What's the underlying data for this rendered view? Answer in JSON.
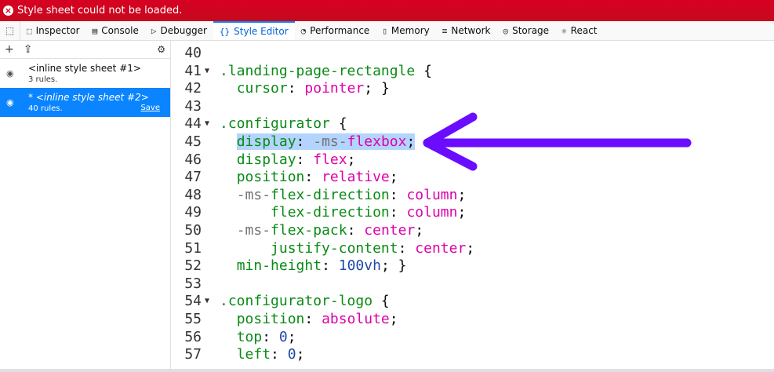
{
  "error_bar": {
    "message": "Style sheet could not be loaded."
  },
  "toolbar": {
    "tabs": [
      {
        "label": "Inspector",
        "icon": "inspector-icon",
        "glyph": "⬚"
      },
      {
        "label": "Console",
        "icon": "console-icon",
        "glyph": "▤"
      },
      {
        "label": "Debugger",
        "icon": "debugger-icon",
        "glyph": "▷"
      },
      {
        "label": "Style Editor",
        "icon": "style-editor-icon",
        "glyph": "{}"
      },
      {
        "label": "Performance",
        "icon": "performance-icon",
        "glyph": "◔"
      },
      {
        "label": "Memory",
        "icon": "memory-icon",
        "glyph": "▯"
      },
      {
        "label": "Network",
        "icon": "network-icon",
        "glyph": "≡"
      },
      {
        "label": "Storage",
        "icon": "storage-icon",
        "glyph": "◎"
      },
      {
        "label": "React",
        "icon": "react-icon",
        "glyph": "⚛"
      }
    ],
    "selected_tab": "Style Editor"
  },
  "sidebar": {
    "sheets": [
      {
        "name": "<inline style sheet #1>",
        "rules": "3 rules."
      },
      {
        "name": "* <inline style sheet #2>",
        "rules": "40 rules.",
        "save_label": "Save"
      }
    ]
  },
  "editor": {
    "lines": [
      {
        "n": "40",
        "fold": false,
        "tokens": []
      },
      {
        "n": "41",
        "fold": true,
        "tokens": [
          [
            "sel",
            ".landing-page-rectangle"
          ],
          [
            "pun",
            " {"
          ]
        ]
      },
      {
        "n": "42",
        "fold": false,
        "tokens": [
          [
            "pun",
            "  "
          ],
          [
            "prop",
            "cursor"
          ],
          [
            "pun",
            ": "
          ],
          [
            "val",
            "pointer"
          ],
          [
            "pun",
            "; }"
          ]
        ]
      },
      {
        "n": "43",
        "fold": false,
        "tokens": []
      },
      {
        "n": "44",
        "fold": true,
        "tokens": [
          [
            "sel",
            ".configurator"
          ],
          [
            "pun",
            " {"
          ]
        ]
      },
      {
        "n": "45",
        "fold": false,
        "highlight": true,
        "tokens": [
          [
            "prop",
            "display"
          ],
          [
            "pun",
            ": "
          ],
          [
            "vendor",
            "-ms-"
          ],
          [
            "val",
            "flexbox"
          ],
          [
            "pun",
            ";"
          ]
        ]
      },
      {
        "n": "46",
        "fold": false,
        "tokens": [
          [
            "pun",
            "  "
          ],
          [
            "prop",
            "display"
          ],
          [
            "pun",
            ": "
          ],
          [
            "val",
            "flex"
          ],
          [
            "pun",
            ";"
          ]
        ]
      },
      {
        "n": "47",
        "fold": false,
        "tokens": [
          [
            "pun",
            "  "
          ],
          [
            "prop",
            "position"
          ],
          [
            "pun",
            ": "
          ],
          [
            "val",
            "relative"
          ],
          [
            "pun",
            ";"
          ]
        ]
      },
      {
        "n": "48",
        "fold": false,
        "tokens": [
          [
            "pun",
            "  "
          ],
          [
            "vendor",
            "-ms-"
          ],
          [
            "prop",
            "flex-direction"
          ],
          [
            "pun",
            ": "
          ],
          [
            "val",
            "column"
          ],
          [
            "pun",
            ";"
          ]
        ]
      },
      {
        "n": "49",
        "fold": false,
        "tokens": [
          [
            "pun",
            "      "
          ],
          [
            "prop",
            "flex-direction"
          ],
          [
            "pun",
            ": "
          ],
          [
            "val",
            "column"
          ],
          [
            "pun",
            ";"
          ]
        ]
      },
      {
        "n": "50",
        "fold": false,
        "tokens": [
          [
            "pun",
            "  "
          ],
          [
            "vendor",
            "-ms-"
          ],
          [
            "prop",
            "flex-pack"
          ],
          [
            "pun",
            ": "
          ],
          [
            "val",
            "center"
          ],
          [
            "pun",
            ";"
          ]
        ]
      },
      {
        "n": "51",
        "fold": false,
        "tokens": [
          [
            "pun",
            "      "
          ],
          [
            "prop",
            "justify-content"
          ],
          [
            "pun",
            ": "
          ],
          [
            "val",
            "center"
          ],
          [
            "pun",
            ";"
          ]
        ]
      },
      {
        "n": "52",
        "fold": false,
        "tokens": [
          [
            "pun",
            "  "
          ],
          [
            "prop",
            "min-height"
          ],
          [
            "pun",
            ": "
          ],
          [
            "num",
            "100vh"
          ],
          [
            "pun",
            "; }"
          ]
        ]
      },
      {
        "n": "53",
        "fold": false,
        "tokens": []
      },
      {
        "n": "54",
        "fold": true,
        "tokens": [
          [
            "sel",
            ".configurator-logo"
          ],
          [
            "pun",
            " {"
          ]
        ]
      },
      {
        "n": "55",
        "fold": false,
        "tokens": [
          [
            "pun",
            "  "
          ],
          [
            "prop",
            "position"
          ],
          [
            "pun",
            ": "
          ],
          [
            "val",
            "absolute"
          ],
          [
            "pun",
            ";"
          ]
        ]
      },
      {
        "n": "56",
        "fold": false,
        "tokens": [
          [
            "pun",
            "  "
          ],
          [
            "prop",
            "top"
          ],
          [
            "pun",
            ": "
          ],
          [
            "num",
            "0"
          ],
          [
            "pun",
            ";"
          ]
        ]
      },
      {
        "n": "57",
        "fold": false,
        "tokens": [
          [
            "pun",
            "  "
          ],
          [
            "prop",
            "left"
          ],
          [
            "pun",
            ": "
          ],
          [
            "num",
            "0"
          ],
          [
            "pun",
            ";"
          ]
        ]
      }
    ]
  },
  "colors": {
    "error_bg": "#d70022",
    "accent": "#0a84ff",
    "arrow": "#6a0dff"
  }
}
